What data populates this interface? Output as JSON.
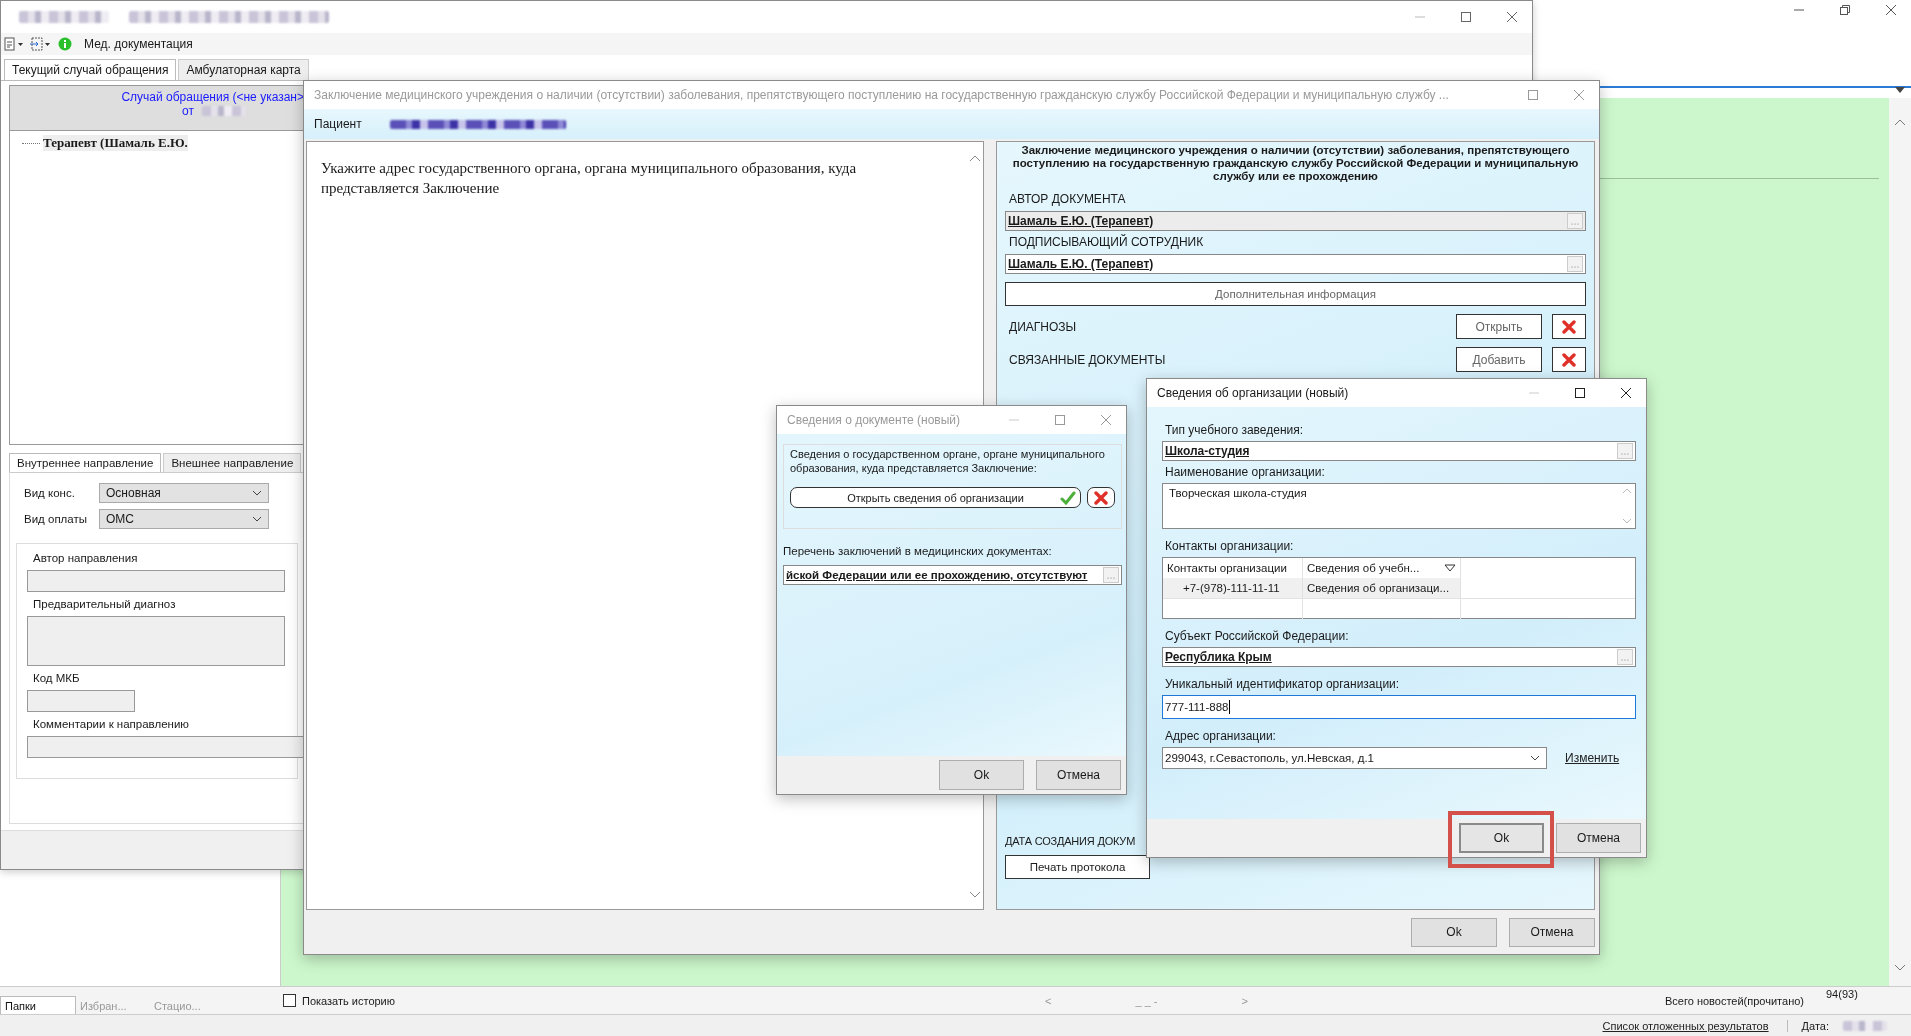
{
  "background_app": {
    "folder_tabs": [
      {
        "label": "Папки",
        "selected": true
      },
      {
        "label": "Избран...",
        "selected": false
      },
      {
        "label": "Стацио...",
        "selected": false
      }
    ],
    "show_history": {
      "label": "Показать историю",
      "checked": false
    },
    "pager": {
      "prev": "<",
      "page": "_ _ -",
      "next": ">"
    },
    "news": {
      "label": "Всего новостей(прочитано)",
      "count": "94(93)"
    },
    "status_bar": {
      "link": "Список отложенных результатов",
      "date_label": "Дата:"
    }
  },
  "back_window": {
    "toolbar_label": "Мед. документация",
    "tabs": [
      {
        "label": "Текущий случай обращения",
        "selected": true
      },
      {
        "label": "Амбулаторная карта",
        "selected": false
      }
    ],
    "case_header": {
      "title": "Случай обращения (<не указан>",
      "date_prefix": "от"
    },
    "tree": [
      {
        "label": "Терапевт (Шамаль Е.Ю."
      }
    ],
    "direction_tabs": [
      {
        "label": "Внутреннее направление",
        "selected": true
      },
      {
        "label": "Внешнее направление",
        "selected": false
      }
    ],
    "selects": [
      {
        "label": "Вид конс.",
        "value": "Основная"
      },
      {
        "label": "Вид оплаты",
        "value": "ОМС"
      }
    ],
    "fields": [
      {
        "label": "Автор направления",
        "kind": "line"
      },
      {
        "label": "Предварительный диагноз",
        "kind": "area"
      },
      {
        "label": "Код МКБ",
        "kind": "short"
      },
      {
        "label": "Комментарии к направлению",
        "kind": "line"
      }
    ]
  },
  "main_dialog": {
    "title": "Заключение медицинского учреждения о наличии (отсутствии) заболевания, препятствующего поступлению на государственную гражданскую службу Российской Федерации и муниципальную службу ...",
    "patient_label": "Пациент",
    "prompt": "Укажите адрес государственного органа, органа муниципального образования, куда представляется Заключение",
    "heading": "Заключение медицинского учреждения о наличии (отсутствии) заболевания, препятствующего поступлению на государственную гражданскую службу Российской Федерации и муниципальную службу или ее прохождению",
    "author": {
      "label": "АВТОР ДОКУМЕНТА",
      "value": "Шамаль Е.Ю. (Терапевт)",
      "disabled": true
    },
    "signer": {
      "label": "ПОДПИСЫВАЮЩИЙ СОТРУДНИК",
      "value": "Шамаль Е.Ю. (Терапевт)",
      "disabled": false
    },
    "extra_button": "Дополнительная информация",
    "sections": [
      {
        "label": "ДИАГНОЗЫ",
        "button": "Открыть"
      },
      {
        "label": "СВЯЗАННЫЕ ДОКУМЕНТЫ",
        "button": "Добавить"
      }
    ],
    "created_label": "ДАТА СОЗДАНИЯ ДОКУМ",
    "print_button": "Печать протокола",
    "buttons": [
      "Ok",
      "Отмена"
    ]
  },
  "document_dialog": {
    "title": "Сведения о документе (новый)",
    "group_label": "Сведения о государственном органе, органе муниципального образования, куда представляется Заключение:",
    "open_button": "Открыть сведения об организации",
    "filled": true,
    "list_label": "Перечень заключений в медицинских документах:",
    "list_value": "йской Федерации или ее прохождению, отсутствуют",
    "buttons": [
      "Ok",
      "Отмена"
    ]
  },
  "organization_dialog": {
    "title": "Сведения об организации (новый)",
    "type": {
      "label": "Тип учебного заведения:",
      "value": "Школа-студия"
    },
    "name": {
      "label": "Наименование организации:",
      "value": "Творческая школа-студия"
    },
    "contacts": {
      "label": "Контакты организации:",
      "columns": [
        "Контакты организации",
        "Сведения об учебн..."
      ],
      "rows": [
        [
          "+7-(978)-111-11-11",
          "Сведения об организаци..."
        ]
      ]
    },
    "subject": {
      "label": "Субъект Российской Федерации:",
      "value": "Республика Крым"
    },
    "uid": {
      "label": "Уникальный идентификатор организации:",
      "value": "777-111-888"
    },
    "address": {
      "label": "Адрес организации:",
      "value": "299043, г.Севастополь, ул.Невская, д.1",
      "link": "Изменить"
    },
    "buttons": [
      "Ok",
      "Отмена"
    ]
  }
}
